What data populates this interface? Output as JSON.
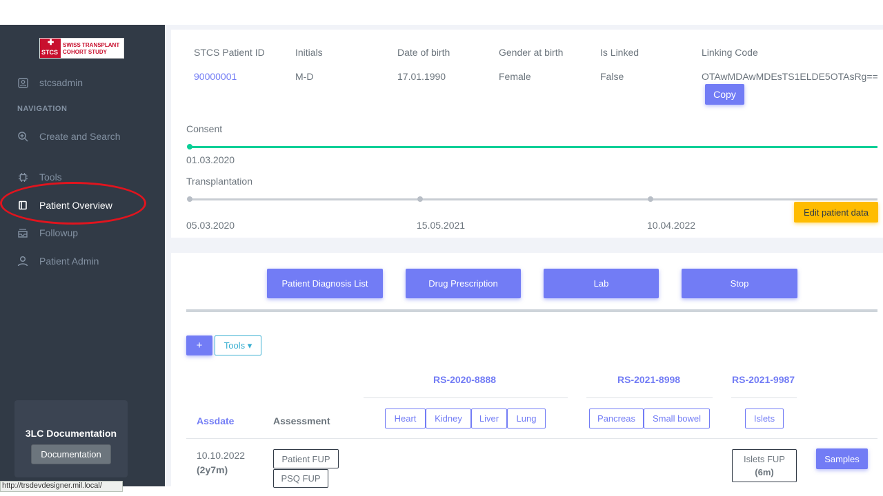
{
  "sidebar": {
    "logo": {
      "short": "STCS",
      "line1": "SWISS TRANSPLANT",
      "line2": "COHORT STUDY"
    },
    "user": "stcsadmin",
    "nav_title": "NAVIGATION",
    "items": [
      {
        "label": "Create and Search",
        "icon": "search-plus-icon"
      },
      {
        "label": "Tools",
        "icon": "chip-icon"
      },
      {
        "label": "Patient Overview",
        "icon": "book-icon",
        "active": true
      },
      {
        "label": "Followup",
        "icon": "inbox-icon"
      },
      {
        "label": "Patient Admin",
        "icon": "user-icon"
      }
    ],
    "doc_card": {
      "title": "3LC Documentation",
      "button": "Documentation"
    },
    "status_url": "http://trsdevdesigner.mil.local/"
  },
  "patient": {
    "headers": [
      "STCS Patient ID",
      "Initials",
      "Date of birth",
      "Gender at birth",
      "Is Linked",
      "Linking Code"
    ],
    "values": [
      "90000001",
      "M-D",
      "17.01.1990",
      "Female",
      "False",
      "OTAwMDAwMDEsTS1ELDE5OTAsRg=="
    ],
    "copy_label": "Copy"
  },
  "timeline": {
    "consent_label": "Consent",
    "consent_date": "01.03.2020",
    "transplantation_label": "Transplantation",
    "transplant_dates": [
      "05.03.2020",
      "15.05.2021",
      "10.04.2022"
    ],
    "edit_label": "Edit patient data"
  },
  "actions": [
    "Patient Diagnosis List",
    "Drug Prescription",
    "Lab",
    "Stop"
  ],
  "toolbar": {
    "add_label": "+",
    "tools_label": "Tools ▾"
  },
  "table": {
    "assdate_header": "Assdate",
    "assessment_header": "Assessment",
    "groups": [
      {
        "id": "RS-2020-8888",
        "organs": [
          "Heart",
          "Kidney",
          "Liver",
          "Lung"
        ]
      },
      {
        "id": "RS-2021-8998",
        "organs": [
          "Pancreas",
          "Small bowel"
        ]
      },
      {
        "id": "RS-2021-9987",
        "organs": [
          "Islets"
        ]
      }
    ],
    "row": {
      "date": "10.10.2022",
      "elapsed": "(2y7m)",
      "assessments": [
        "Patient FUP",
        "PSQ FUP"
      ],
      "islets_fup": "Islets FUP",
      "islets_fup_sub": "(6m)",
      "samples_label": "Samples"
    }
  },
  "colors": {
    "primary": "#727cf5",
    "success": "#0acf97",
    "warning": "#ffbc00",
    "sidebar": "#313a46",
    "highlight": "#e0141e"
  }
}
